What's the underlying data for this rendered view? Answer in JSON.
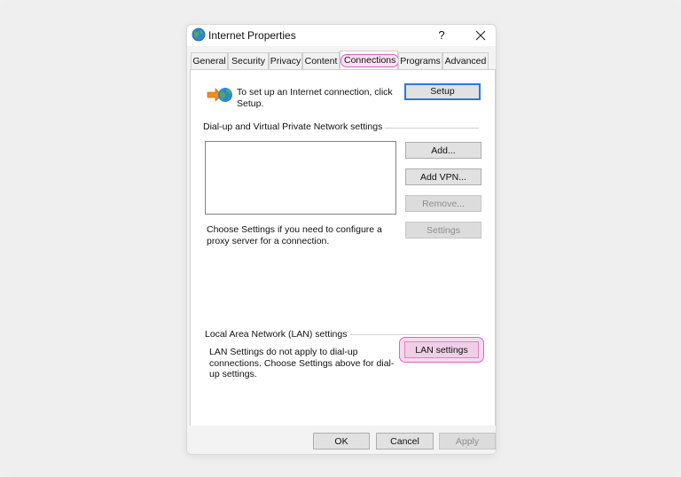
{
  "window": {
    "title": "Internet Properties",
    "help_label": "?",
    "close_icon": "close-icon",
    "app_icon": "globe-icon"
  },
  "tabs": [
    {
      "label": "General"
    },
    {
      "label": "Security"
    },
    {
      "label": "Privacy"
    },
    {
      "label": "Content"
    },
    {
      "label": "Connections",
      "active": true
    },
    {
      "label": "Programs"
    },
    {
      "label": "Advanced"
    }
  ],
  "setup": {
    "text": "To set up an Internet connection, click Setup.",
    "button": "Setup",
    "icon": "connection-wizard-icon"
  },
  "dialup": {
    "group_label": "Dial-up and Virtual Private Network settings",
    "add_button": "Add...",
    "add_vpn_button": "Add VPN...",
    "remove_button": "Remove...",
    "settings_button": "Settings",
    "proxy_text": "Choose Settings if you need to configure a proxy server for a connection."
  },
  "lan": {
    "group_label": "Local Area Network (LAN) settings",
    "text": "LAN Settings do not apply to dial-up connections. Choose Settings above for dial-up settings.",
    "button": "LAN settings"
  },
  "footer": {
    "ok": "OK",
    "cancel": "Cancel",
    "apply": "Apply"
  },
  "colors": {
    "highlight_border": "#e35fc0",
    "highlight_fill": "#f7d9ef",
    "default_button_border": "#2a7ad6"
  }
}
